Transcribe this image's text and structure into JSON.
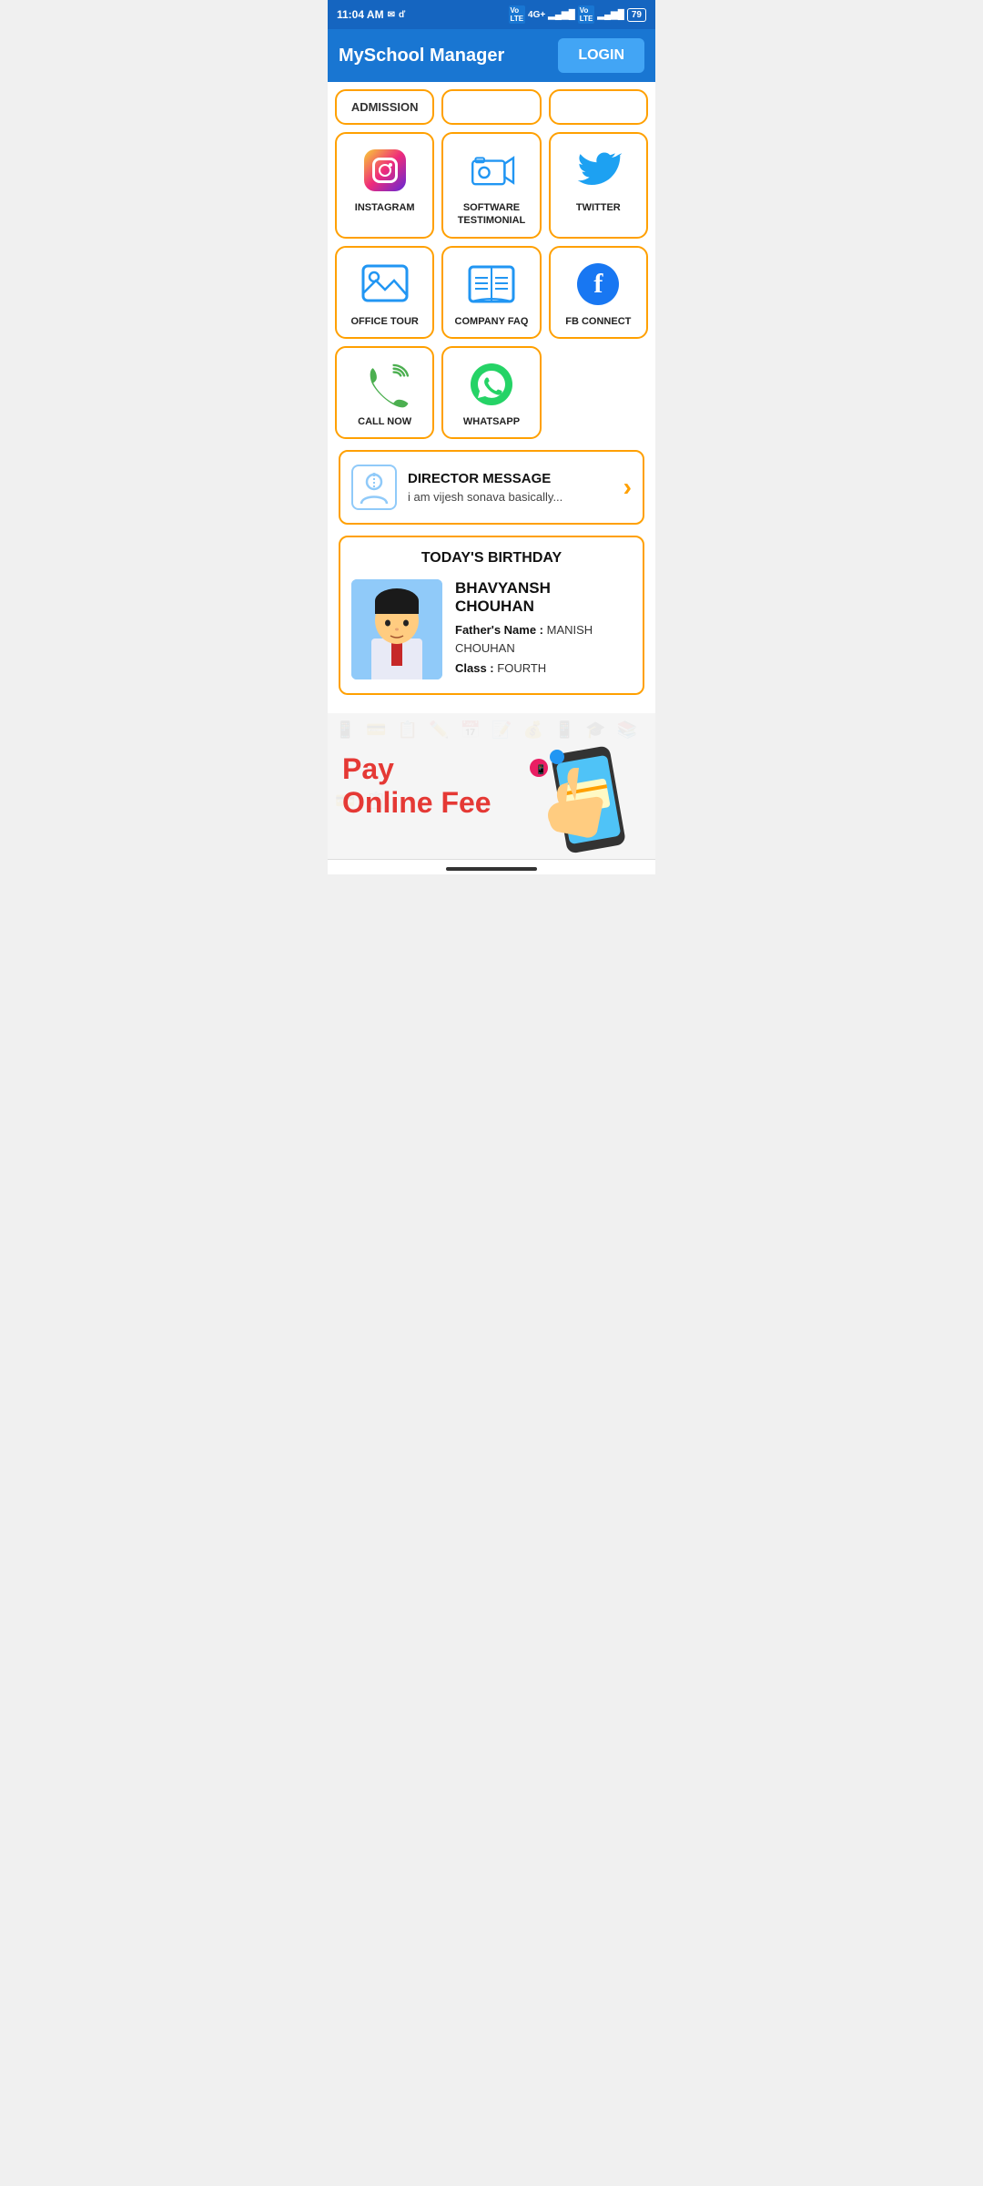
{
  "app": {
    "title": "MySchool Manager",
    "login_label": "LOGIN"
  },
  "status_bar": {
    "time": "11:04 AM",
    "battery": "79"
  },
  "grid_row1": [
    {
      "id": "admission",
      "label": "ADMISSION",
      "icon": "admission-icon"
    },
    {
      "id": "empty1",
      "label": "",
      "icon": ""
    },
    {
      "id": "empty2",
      "label": "",
      "icon": ""
    }
  ],
  "grid_row2": [
    {
      "id": "instagram",
      "label": "INSTAGRAM",
      "icon": "instagram-icon"
    },
    {
      "id": "software-testimonial",
      "label": "SOFTWARE\nTESTIMONIAL",
      "icon": "camera-icon"
    },
    {
      "id": "twitter",
      "label": "TWITTER",
      "icon": "twitter-icon"
    }
  ],
  "grid_row3": [
    {
      "id": "office-tour",
      "label": "OFFICE TOUR",
      "icon": "image-icon"
    },
    {
      "id": "company-faq",
      "label": "COMPANY FAQ",
      "icon": "book-icon"
    },
    {
      "id": "fb-connect",
      "label": "FB CONNECT",
      "icon": "facebook-icon"
    }
  ],
  "grid_row4": [
    {
      "id": "call-now",
      "label": "CALL NOW",
      "icon": "phone-icon"
    },
    {
      "id": "whatsapp",
      "label": "WHATSAPP",
      "icon": "whatsapp-icon"
    }
  ],
  "director": {
    "title": "DIRECTOR MESSAGE",
    "subtitle": "i am vijesh sonava basically..."
  },
  "birthday": {
    "section_title": "TODAY'S BIRTHDAY",
    "student_name": "BHAVYANSH CHOUHAN",
    "father_label": "Father's Name :",
    "father_name": "MANISH CHOUHAN",
    "class_label": "Class :",
    "class_name": "FOURTH"
  },
  "pay_banner": {
    "line1": "Pay",
    "line2": "Online Fee"
  }
}
